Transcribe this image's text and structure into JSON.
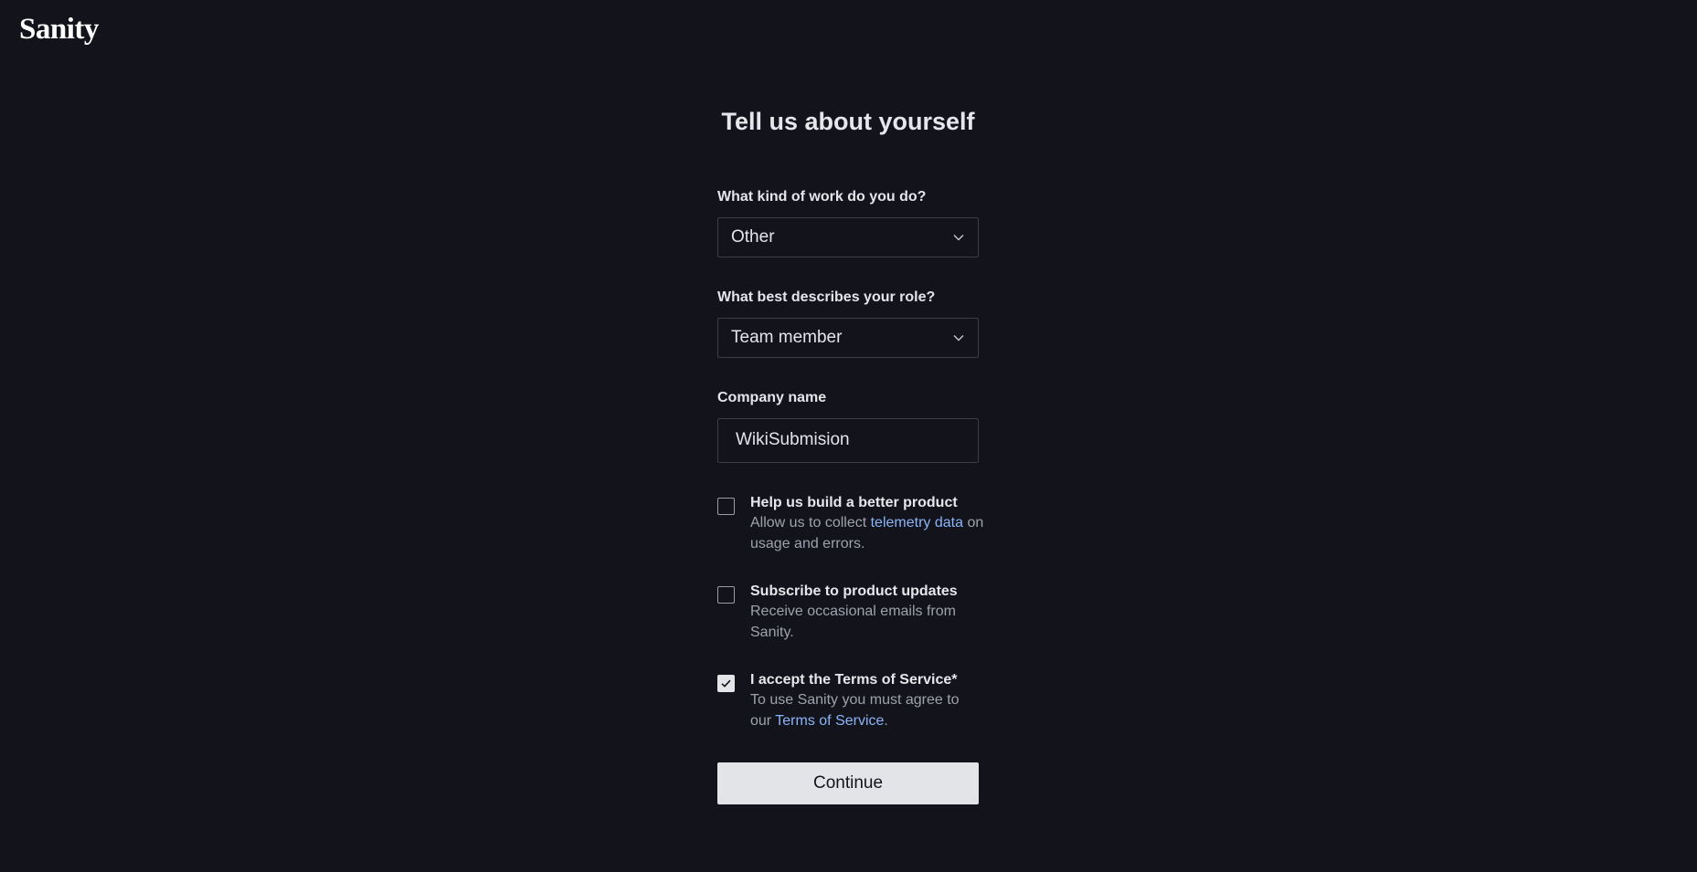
{
  "brand": {
    "logo_text": "Sanity"
  },
  "form": {
    "title": "Tell us about yourself",
    "work": {
      "label": "What kind of work do you do?",
      "value": "Other"
    },
    "role": {
      "label": "What best describes your role?",
      "value": "Team member"
    },
    "company": {
      "label": "Company name",
      "value": "WikiSubmision"
    },
    "telemetry": {
      "checked": false,
      "title": "Help us build a better product",
      "desc_before": "Allow us to collect ",
      "link": "telemetry data",
      "desc_after": " on usage and errors."
    },
    "updates": {
      "checked": false,
      "title": "Subscribe to product updates",
      "desc": "Receive occasional emails from Sanity."
    },
    "terms": {
      "checked": true,
      "title": "I accept the Terms of Service*",
      "desc_before": "To use Sanity you must agree to our ",
      "link": "Terms of Service",
      "desc_after": "."
    },
    "continue_label": "Continue"
  },
  "icons": {
    "select_chevron": "chevron-down-icon",
    "checkmark": "checkmark-icon"
  },
  "colors": {
    "background": "#13141b",
    "link": "#8ab4f8",
    "button_bg": "#e3e4e8"
  }
}
